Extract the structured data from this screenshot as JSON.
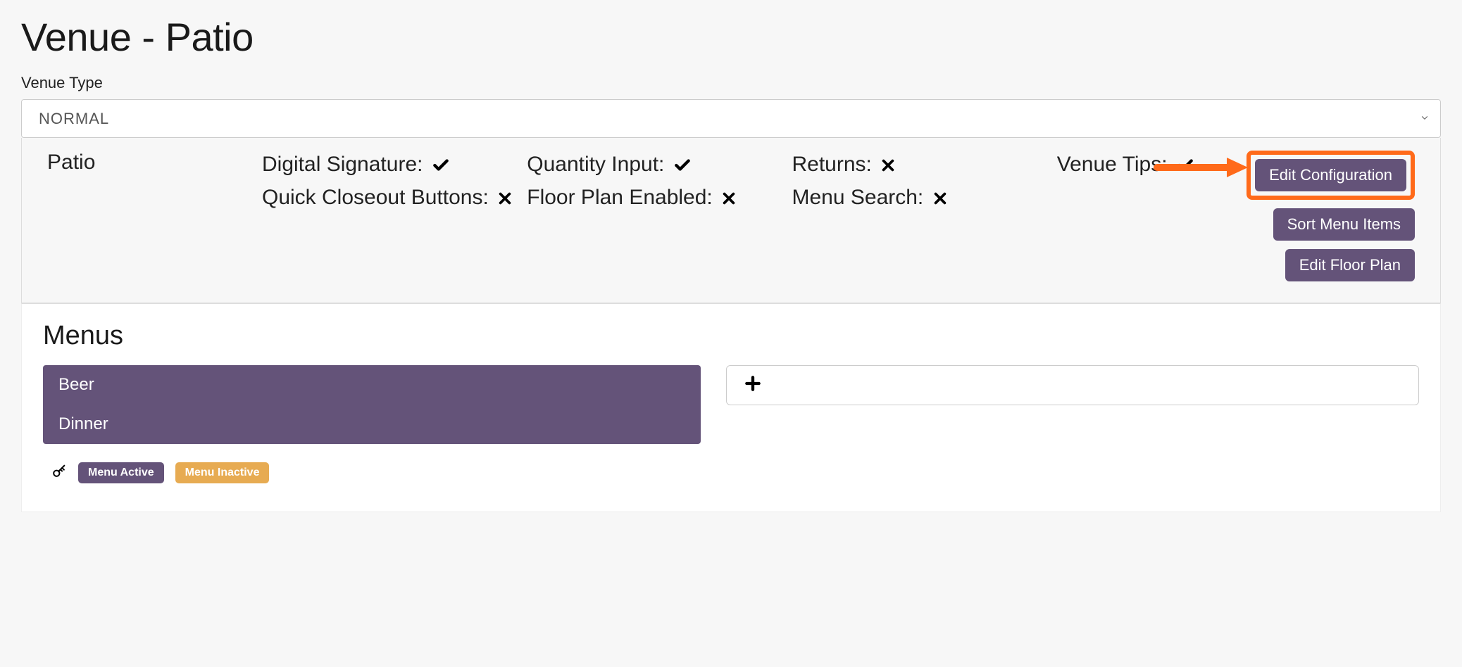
{
  "page_title": "Venue - Patio",
  "venue_type_label": "Venue Type",
  "venue_type_selected": "NORMAL",
  "venue_name": "Patio",
  "config": {
    "digital_signature": {
      "label": "Digital Signature:",
      "value": true
    },
    "quick_closeout_buttons": {
      "label": "Quick Closeout Buttons:",
      "value": false
    },
    "quantity_input": {
      "label": "Quantity Input:",
      "value": true
    },
    "floor_plan_enabled": {
      "label": "Floor Plan Enabled:",
      "value": false
    },
    "returns": {
      "label": "Returns:",
      "value": false
    },
    "menu_search": {
      "label": "Menu Search:",
      "value": false
    },
    "venue_tips": {
      "label": "Venue Tips:",
      "value": true
    }
  },
  "buttons": {
    "edit_configuration": "Edit Configuration",
    "sort_menu_items": "Sort Menu Items",
    "edit_floor_plan": "Edit Floor Plan"
  },
  "menus": {
    "heading": "Menus",
    "items": [
      "Beer",
      "Dinner"
    ],
    "legend": {
      "active": "Menu Active",
      "inactive": "Menu Inactive"
    }
  }
}
